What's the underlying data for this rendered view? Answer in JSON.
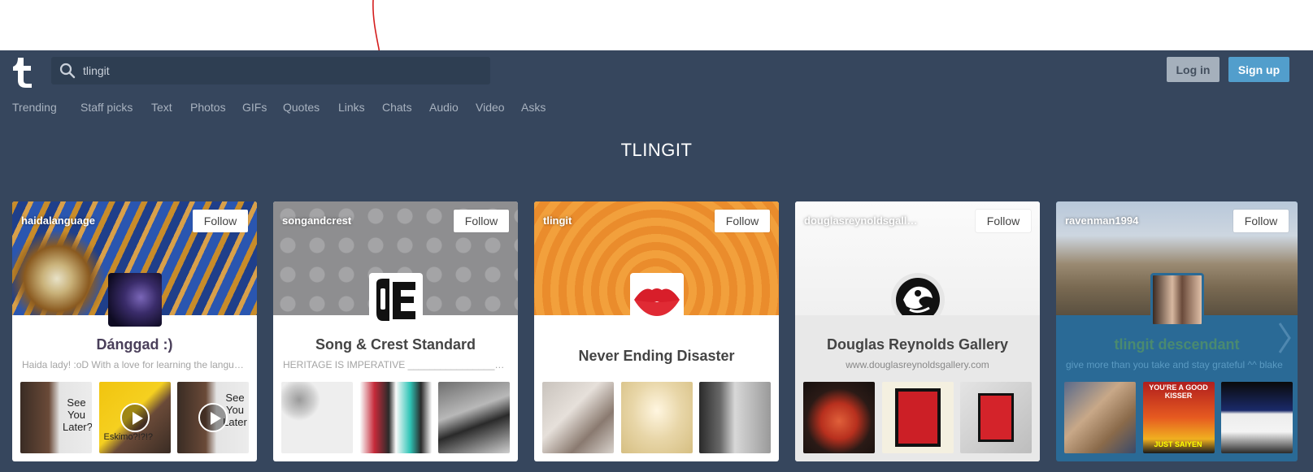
{
  "search": {
    "query": "tlingit"
  },
  "auth": {
    "login_label": "Log in",
    "signup_label": "Sign up"
  },
  "nav": [
    "Trending",
    "Staff picks",
    "Text",
    "Photos",
    "GIFs",
    "Quotes",
    "Links",
    "Chats",
    "Audio",
    "Video",
    "Asks"
  ],
  "page_title": "TLINGIT",
  "follow_label": "Follow",
  "cards": [
    {
      "username": "haidalanguage",
      "blog_title": "Dánggad :)",
      "description": "Haida lady! :oD With a love for learning the langu…",
      "thumb_texts": [
        "See You Later?",
        "Eskimo?!?!?",
        "See You Later"
      ]
    },
    {
      "username": "songandcrest",
      "blog_title": "Song & Crest Standard",
      "description": "HERITAGE IS IMPERATIVE ____________________…"
    },
    {
      "username": "tlingit",
      "blog_title": "Never Ending Disaster",
      "description": ""
    },
    {
      "username": "douglasreynoldsgall…",
      "blog_title": "Douglas Reynolds Gallery",
      "description": "www.douglasreynoldsgallery.com"
    },
    {
      "username": "ravenman1994",
      "blog_title": "tlingit descendant",
      "description": "give more than you take and stay grateful ^^ blake",
      "thumb_texts": [
        "YOU'RE A GOOD KISSER",
        "JUST SAIYEN"
      ]
    }
  ],
  "colors": {
    "dashboard": "#36465d",
    "signup": "#529ecc",
    "login": "#a5b0bc",
    "annotation": "#d41e1e"
  }
}
